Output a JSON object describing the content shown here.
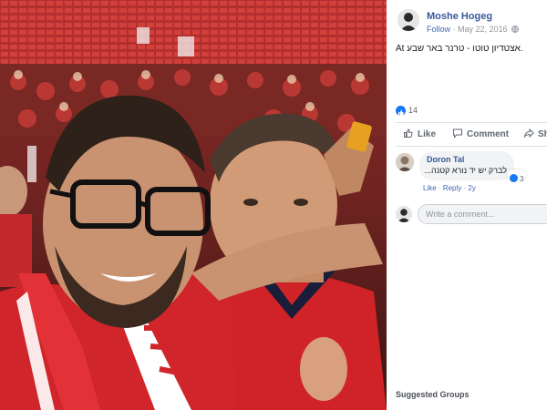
{
  "post": {
    "author": "Moshe Hogeg",
    "follow_label": "Follow",
    "date": "May 22, 2016",
    "text": "At אצטדיון טוטו - טרנר באר שבע.",
    "reaction_count": "14"
  },
  "actions": {
    "like_label": "Like",
    "comment_label": "Comment",
    "share_label": "Share"
  },
  "comments": [
    {
      "author": "Doron Tal",
      "text": "לברק יש יד נורא קטנה...",
      "reaction_count": "3",
      "like_link": "Like",
      "reply_link": "Reply",
      "age": "2y"
    }
  ],
  "composer": {
    "placeholder": "Write a comment..."
  },
  "sidebar": {
    "suggested_groups_label": "Suggested Groups"
  },
  "icons": {
    "globe": "globe-icon",
    "like": "thumbs-up-icon",
    "comment": "speech-bubble-icon",
    "share": "share-arrow-icon",
    "emoji": "smiley-icon"
  },
  "colors": {
    "link_blue": "#385898",
    "like_blue": "#1877f2",
    "jersey_red": "#d4262b"
  }
}
